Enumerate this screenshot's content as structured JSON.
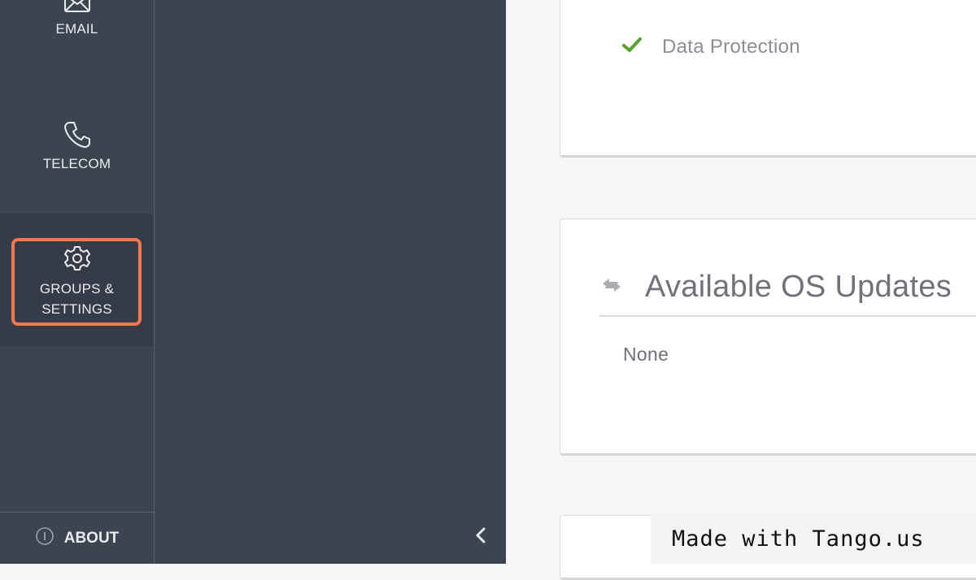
{
  "nav": {
    "email_label": "EMAIL",
    "telecom_label": "TELECOM",
    "groups_label_line1": "GROUPS &",
    "groups_label_line2": "SETTINGS",
    "about_label": "ABOUT"
  },
  "status_card": {
    "item_label": "Data Protection",
    "check_color": "#5aa02c"
  },
  "os_updates": {
    "title": "Available OS Updates",
    "value": "None"
  },
  "watermark": {
    "text": "Made with Tango.us"
  },
  "colors": {
    "sidebar_bg": "#3c4450",
    "selected_bg": "#353c47",
    "highlight": "#f4774f"
  },
  "icons": [
    "mail-icon",
    "phone-icon",
    "gear-icon",
    "info-icon",
    "chevron-left-icon",
    "check-icon",
    "refresh-icon"
  ]
}
